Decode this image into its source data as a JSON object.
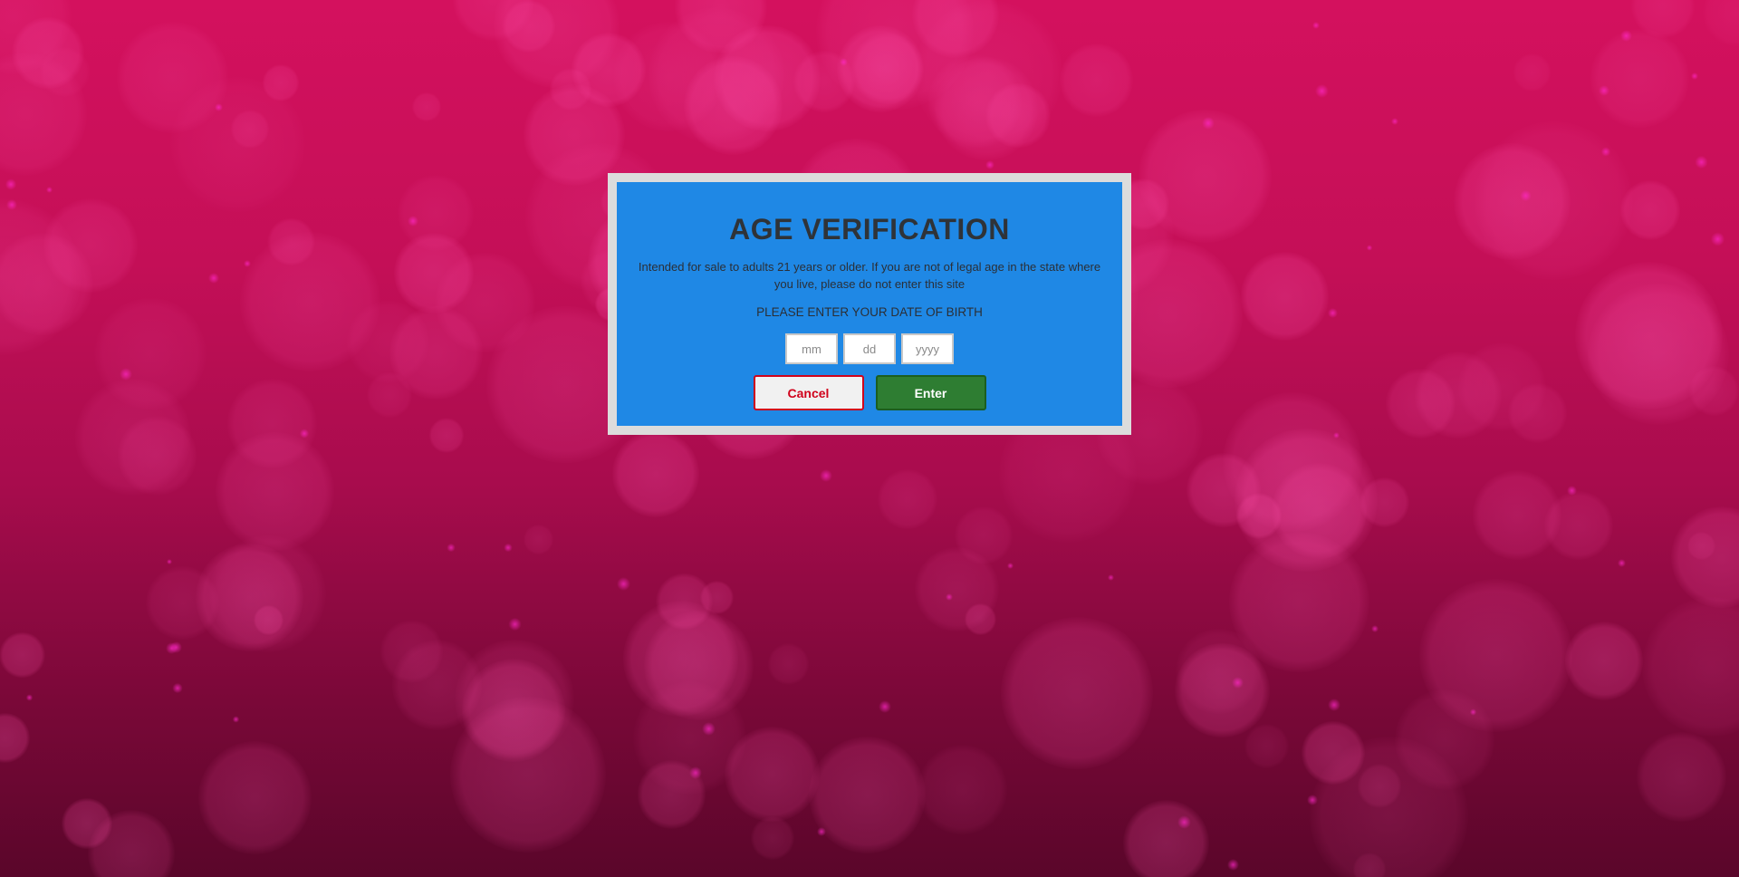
{
  "modal": {
    "title": "AGE VERIFICATION",
    "description": "Intended for sale to adults 21 years or older. If you are not of legal age in the state where you live, please do not enter this site",
    "dob_prompt": "PLEASE ENTER YOUR DATE OF BIRTH",
    "month_placeholder": "mm",
    "day_placeholder": "dd",
    "year_placeholder": "yyyy",
    "month_value": "",
    "day_value": "",
    "year_value": "",
    "cancel_label": "Cancel",
    "enter_label": "Enter"
  },
  "colors": {
    "background": "#c40f57",
    "modal_frame": "#dcdcdc",
    "modal_panel": "#1f88e5",
    "cancel_text": "#d0021b",
    "enter_button": "#2e7d32"
  }
}
